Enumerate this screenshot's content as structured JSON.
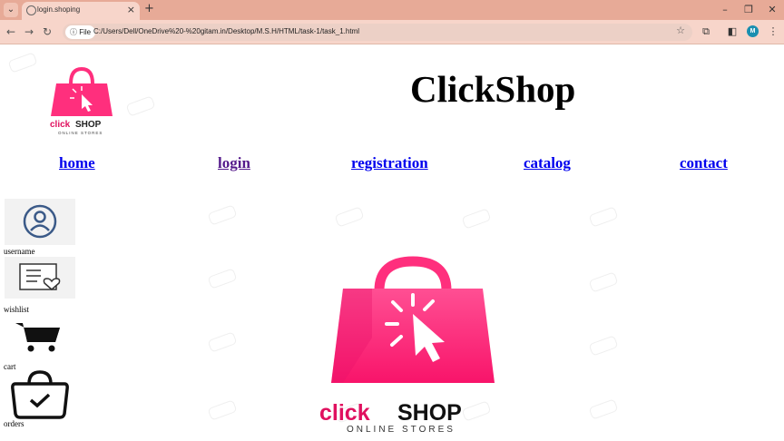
{
  "browser": {
    "tab_title": "login.shoping",
    "new_tab_label": "+",
    "file_chip": "File",
    "url": "C:/Users/Dell/OneDrive%20-%20gitam.in/Desktop/M.S.H/HTML/task-1/task_1.html",
    "profile_initial": "M"
  },
  "header": {
    "logo_text": "click",
    "logo_text_bold": "SHOP",
    "logo_subtext": "ONLINE STORES",
    "title": "ClickShop"
  },
  "nav": {
    "items": [
      {
        "label": "home"
      },
      {
        "label": "login"
      },
      {
        "label": "registration"
      },
      {
        "label": "catalog"
      },
      {
        "label": "contact"
      }
    ]
  },
  "sidebar": {
    "items": [
      {
        "label": "username",
        "icon": "user-icon"
      },
      {
        "label": "wishlist",
        "icon": "wishlist-icon"
      },
      {
        "label": "cart",
        "icon": "cart-icon"
      },
      {
        "label": "orders",
        "icon": "shopping-bag-icon"
      }
    ]
  },
  "main_logo": {
    "text": "click",
    "text_bold": "SHOP",
    "subtext": "ONLINE STORES"
  },
  "colors": {
    "brand_pink": "#ff2f7d",
    "brand_pink_dark": "#e0115f",
    "chrome_tabbar": "#e7aa97",
    "chrome_toolbar": "#f7d5ca"
  }
}
